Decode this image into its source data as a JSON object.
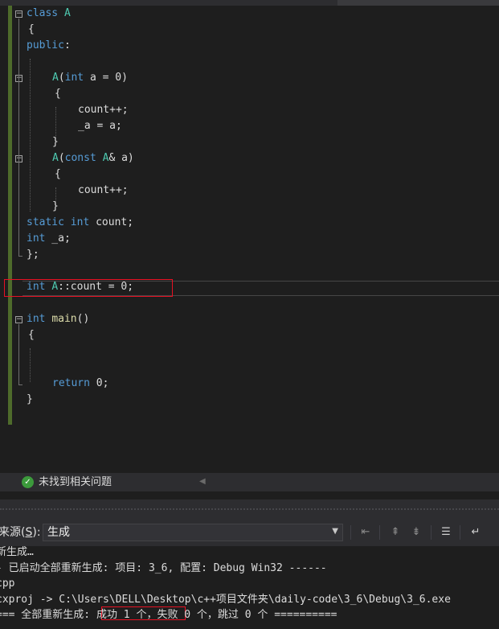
{
  "editor": {
    "lines": [
      [
        {
          "t": "class",
          "c": "kw"
        },
        {
          "t": " "
        },
        {
          "t": "A",
          "c": "ty"
        }
      ],
      [
        {
          "t": "{"
        }
      ],
      [
        {
          "t": "public",
          "c": "kw"
        },
        {
          "t": ":"
        }
      ],
      [],
      [
        {
          "t": "A",
          "c": "ty"
        },
        {
          "t": "("
        },
        {
          "t": "int",
          "c": "kw"
        },
        {
          "t": " a = 0)"
        }
      ],
      [
        {
          "t": "{"
        }
      ],
      [
        {
          "t": "count++;"
        }
      ],
      [
        {
          "t": "_a = a;"
        }
      ],
      [
        {
          "t": "}"
        }
      ],
      [
        {
          "t": "A",
          "c": "ty"
        },
        {
          "t": "("
        },
        {
          "t": "const",
          "c": "kw"
        },
        {
          "t": " "
        },
        {
          "t": "A",
          "c": "ty"
        },
        {
          "t": "& a)"
        }
      ],
      [
        {
          "t": "{"
        }
      ],
      [
        {
          "t": "count++;"
        }
      ],
      [
        {
          "t": "}"
        }
      ],
      [
        {
          "t": "static",
          "c": "kw"
        },
        {
          "t": " "
        },
        {
          "t": "int",
          "c": "kw"
        },
        {
          "t": " count;"
        }
      ],
      [
        {
          "t": "int",
          "c": "kw"
        },
        {
          "t": " _a;"
        }
      ],
      [
        {
          "t": "};"
        }
      ],
      [],
      [
        {
          "t": "int",
          "c": "kw"
        },
        {
          "t": " "
        },
        {
          "t": "A",
          "c": "ty"
        },
        {
          "t": "::count = 0;"
        }
      ],
      [],
      [
        {
          "t": "int",
          "c": "kw"
        },
        {
          "t": " "
        },
        {
          "t": "main",
          "c": "fn"
        },
        {
          "t": "()"
        }
      ],
      [
        {
          "t": "{"
        }
      ],
      [],
      [],
      [
        {
          "t": "return",
          "c": "kw"
        },
        {
          "t": " 0;"
        }
      ],
      [
        {
          "t": "}"
        }
      ]
    ]
  },
  "status": {
    "text": "未找到相关问题"
  },
  "output_panel": {
    "source_label": "来源(S):",
    "source_hotkey": "S",
    "source_value": "生成",
    "lines": [
      "新生成…",
      "- 已启动全部重新生成: 项目: 3_6, 配置: Debug Win32 ------",
      "cpp",
      "cxproj -> C:\\Users\\DELL\\Desktop\\c++项目文件夹\\daily-code\\3_6\\Debug\\3_6.exe",
      "=== 全部重新生成: 成功 1 个，失败 0 个，跳过 0 个 =========="
    ]
  },
  "colors": {
    "keyword": "#569cd6",
    "type": "#4ec9b0",
    "function": "#dcdcaa",
    "highlight_box": "#e81123",
    "success": "#3c9a3c"
  }
}
